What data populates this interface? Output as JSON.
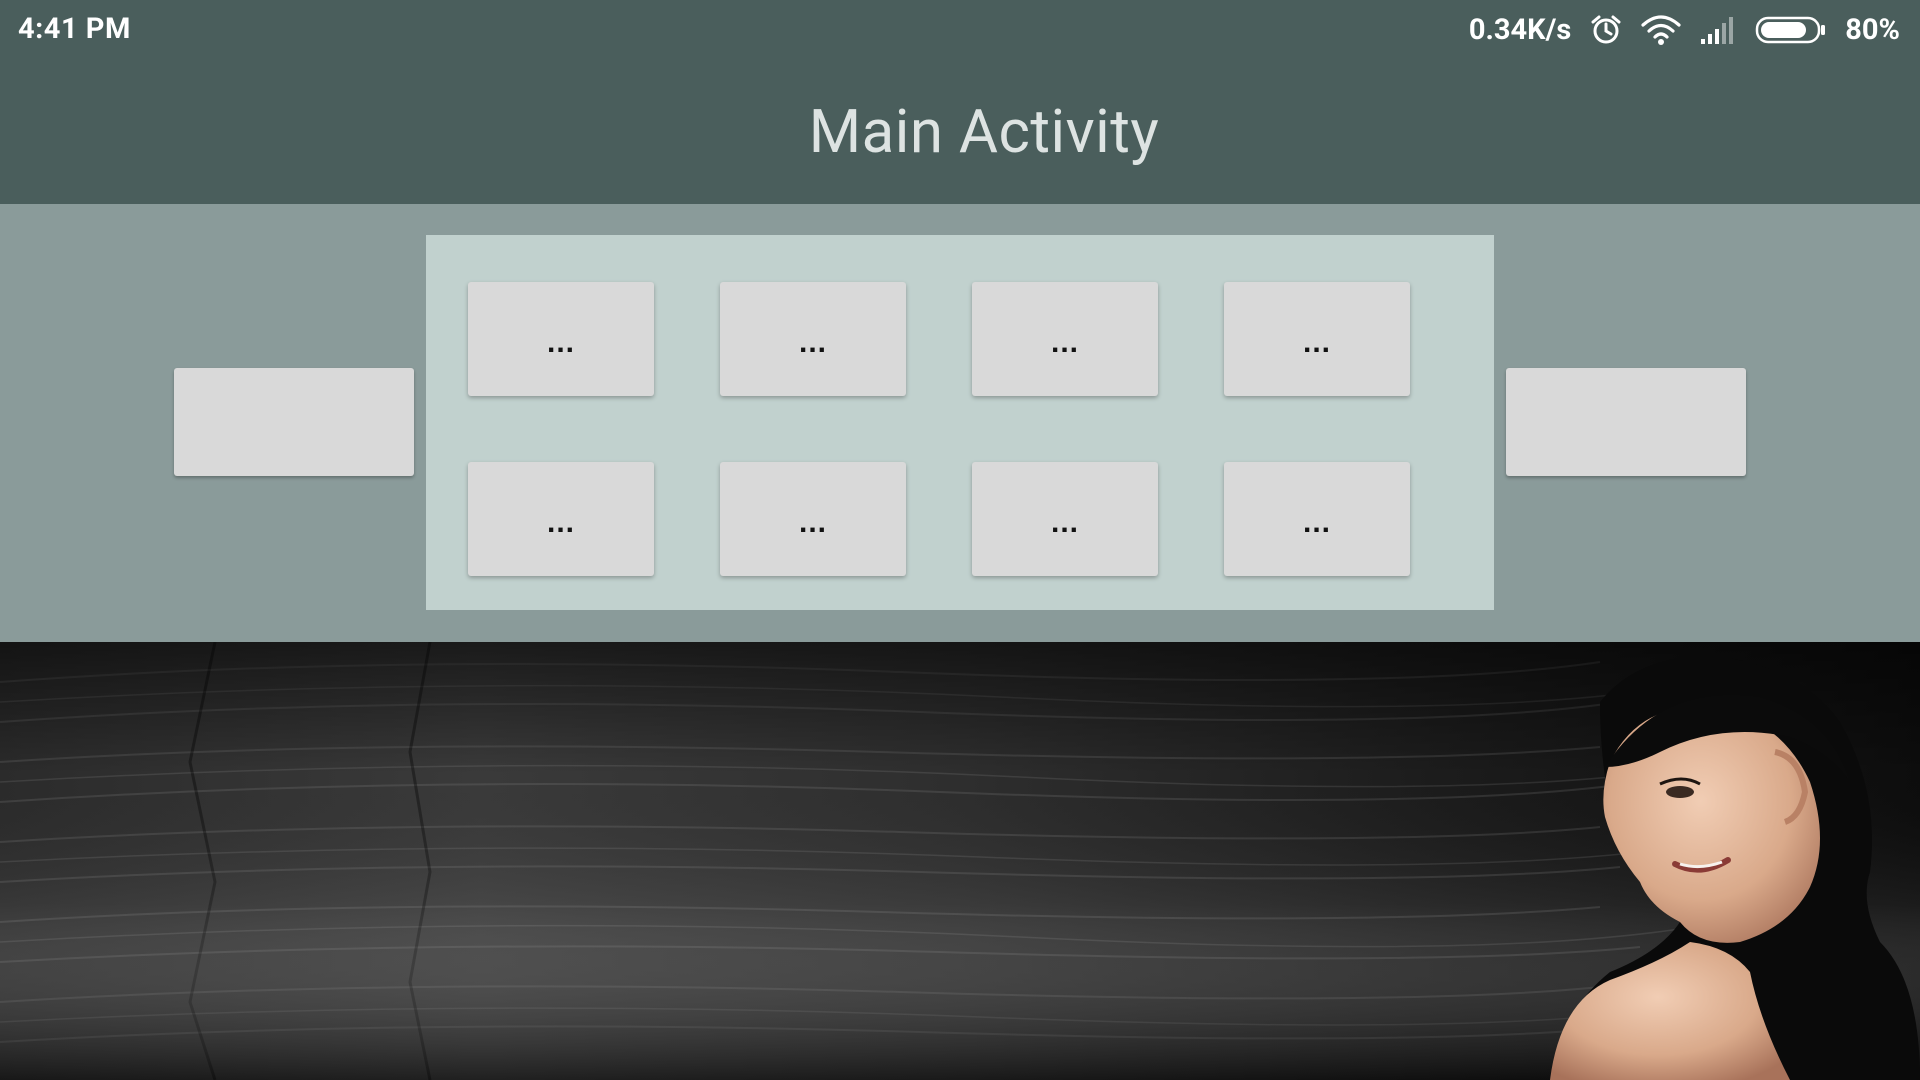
{
  "status_bar": {
    "time": "4:41 PM",
    "net_speed": "0.34K/s",
    "battery_percent": "80%",
    "battery_level": 0.8,
    "icons": [
      "alarm-icon",
      "wifi-icon",
      "signal-icon",
      "battery-icon"
    ]
  },
  "app_bar": {
    "title": "Main Activity"
  },
  "content": {
    "left_button_label": "",
    "right_button_label": "",
    "grid_buttons": [
      {
        "label": "..."
      },
      {
        "label": "..."
      },
      {
        "label": "..."
      },
      {
        "label": "..."
      },
      {
        "label": "..."
      },
      {
        "label": "..."
      },
      {
        "label": "..."
      },
      {
        "label": "..."
      }
    ]
  },
  "colors": {
    "toolbar": "#4a5e5c",
    "content_bg": "#8a9b9a",
    "grid_panel_bg": "#c1d1ce",
    "button_bg": "#d9d9d9"
  },
  "hero_image": {
    "description_icon": "hair-photo"
  }
}
